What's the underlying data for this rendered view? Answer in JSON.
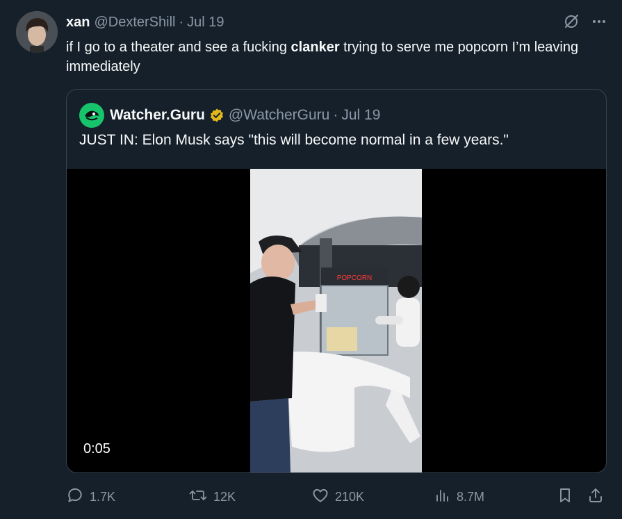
{
  "tweet": {
    "author_name": "xan",
    "author_handle": "@DexterShill",
    "separator": "·",
    "date": "Jul 19",
    "text_before": "if I go to a theater and see a fucking ",
    "text_bold": "clanker",
    "text_after": " trying to serve me popcorn I’m leaving immediately",
    "icons": [
      "grok-slash-icon",
      "more-icon"
    ]
  },
  "quote": {
    "author_name": "Watcher.Guru",
    "author_handle": "@WatcherGuru",
    "separator": "·",
    "date": "Jul 19",
    "text": "JUST IN: Elon Musk says \"this will become normal in a few years.\"",
    "video": {
      "timestamp": "0:05",
      "sign_text": "POPCORN"
    }
  },
  "actions": {
    "replies": "1.7K",
    "reposts": "12K",
    "likes": "210K",
    "views": "8.7M"
  },
  "colors": {
    "background": "#15202b",
    "text": "#f7f9f9",
    "muted": "#8b98a5",
    "border": "#38444d",
    "brand_green": "#18c46b",
    "verified_gold": "#e2b719"
  }
}
